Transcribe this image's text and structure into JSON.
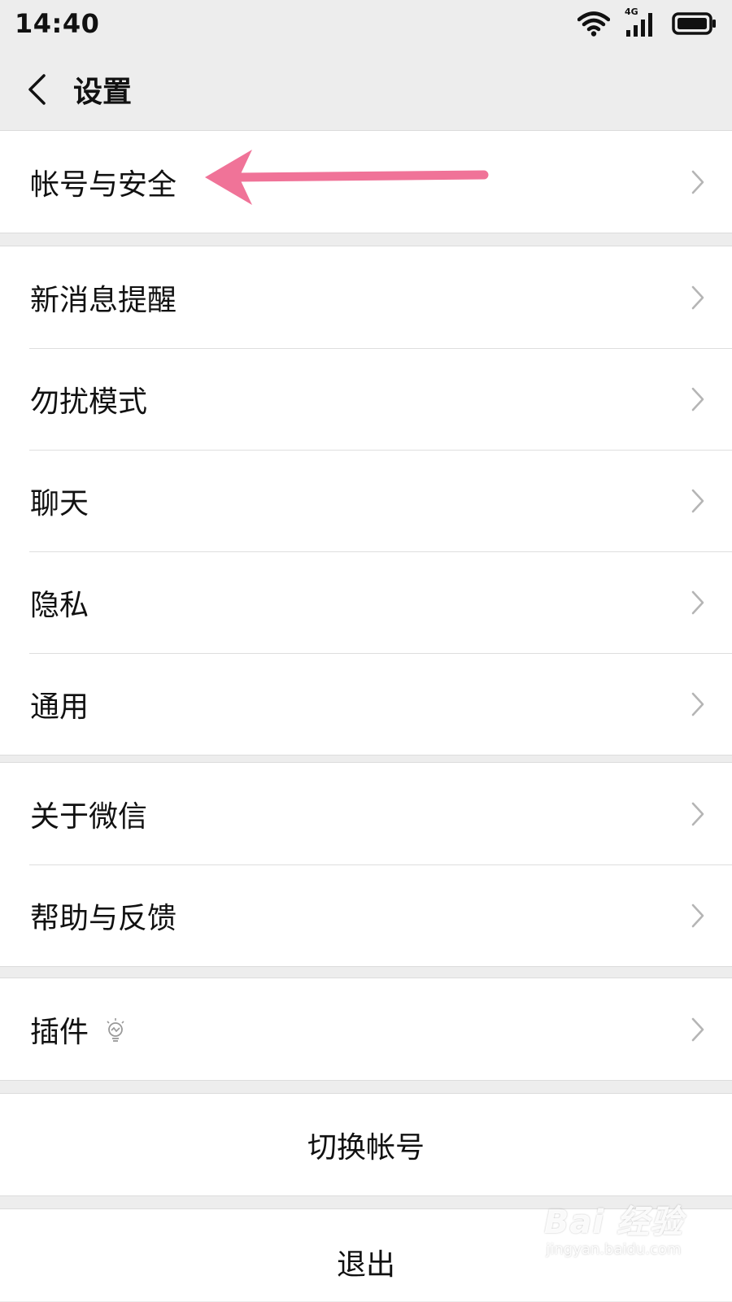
{
  "status": {
    "time": "14:40",
    "network": "4G"
  },
  "header": {
    "title": "设置"
  },
  "groups": [
    {
      "items": [
        {
          "label": "帐号与安全"
        }
      ]
    },
    {
      "items": [
        {
          "label": "新消息提醒"
        },
        {
          "label": "勿扰模式"
        },
        {
          "label": "聊天"
        },
        {
          "label": "隐私"
        },
        {
          "label": "通用"
        }
      ]
    },
    {
      "items": [
        {
          "label": "关于微信"
        },
        {
          "label": "帮助与反馈"
        }
      ]
    },
    {
      "items": [
        {
          "label": "插件"
        }
      ]
    }
  ],
  "actions": {
    "switch_account": "切换帐号",
    "logout": "退出"
  },
  "watermark": {
    "main": "Bai 经验",
    "sub": "jingyan.baidu.com"
  },
  "annotation_color": "#f07398"
}
